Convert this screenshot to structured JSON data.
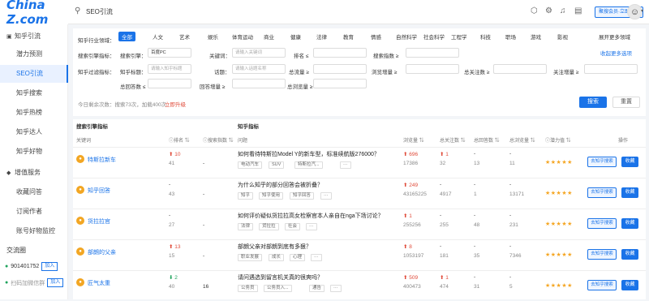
{
  "logo": "China Z.com",
  "topbar": {
    "title": "SEO引流",
    "buy": "聚搜会员·立即升级"
  },
  "sidebar": {
    "section1": "知乎引流",
    "items": [
      "潜力预测",
      "SEO引流",
      "知乎搜索",
      "知乎热榜",
      "知乎达人",
      "知乎好物"
    ],
    "section2": "增值服务",
    "items2": [
      "收藏问答",
      "订阅作者",
      "账号好物监控"
    ],
    "contact_title": "交流圈",
    "contacts": [
      {
        "id": "901401752",
        "add": "加入"
      },
      {
        "id": "扫码加微信群",
        "add": "加入"
      }
    ]
  },
  "filter": {
    "industry_label": "知乎行业领域：",
    "categories": [
      "全部",
      "人文",
      "艺术",
      "娱乐",
      "体育运动",
      "商业",
      "健康",
      "法律",
      "教育",
      "情感",
      "自然科学",
      "社会科学",
      "工程学",
      "科技",
      "职场",
      "游戏",
      "影视"
    ],
    "expand": "展开更多领域",
    "collapse": "收起更多选项",
    "search_filter": "搜索引擎指标：",
    "engine_label": "搜索引擎：",
    "engine_value": "百度PC",
    "keyword_label": "关键词：",
    "keyword_placeholder": "请输入关键词",
    "rank_label": "排名 ≤",
    "search_vol_label": "搜索指数 ≥",
    "zhihu_filter": "知乎过滤指标：",
    "zhihu_title_label": "知乎标题：",
    "zhihu_title_placeholder": "请输入知乎标题",
    "topic_label": "话题：",
    "topic_placeholder": "请输入话题名称",
    "total_flow_label": "总流量 ≥",
    "view_inc_label": "浏览增量 ≥",
    "total_follow_label": "总关注数 ≥",
    "follow_inc_label": "关注增量 ≥",
    "total_answer_label": "总回答数 ≤",
    "answer_inc_label": "回答增量 ≥",
    "total_view_label": "总浏览量 ≥",
    "quota": "今日剩余次数：搜索73次，加载400次",
    "upgrade": "立即升级",
    "search_btn": "搜索",
    "reset_btn": "重置"
  },
  "table": {
    "group1": "搜索引擎指标",
    "group2": "知乎指标",
    "cols": [
      "关键词",
      "ⓘ排名 ⇅",
      "ⓘ搜索指数 ⇅",
      "问题",
      "浏览量 ⇅",
      "总关注数 ⇅",
      "总回答数 ⇅",
      "总浏览量 ⇅",
      "ⓘ潜力值 ⇅",
      "操作"
    ],
    "go_btn": "去知乎搜索",
    "fav_btn": "收藏",
    "rows": [
      {
        "kw": "特斯拉新车",
        "rank": "10",
        "rank_dir": "up",
        "rank_sub": "41",
        "index": "-",
        "q": "如何看待特斯拉Model Y的新车型，标准续航版276000？",
        "tags": [
          "电动汽车",
          "SUV",
          "特斯拉汽..."
        ],
        "view": "696",
        "view_dir": "up",
        "view_sub": "17386",
        "follow": "1",
        "follow_dir": "up",
        "follow_sub": "32",
        "answer": "-",
        "answer_sub": "13",
        "total": "-",
        "total_sub": "11",
        "stars": "★★★★★"
      },
      {
        "kw": "知乎回答",
        "rank": "-",
        "rank_dir": "",
        "rank_sub": "43",
        "index": "-",
        "q": "为什么知乎的部分回答会被折叠？",
        "tags": [
          "知乎",
          "知乎使用",
          "知乎回答"
        ],
        "view": "249",
        "view_dir": "up",
        "view_sub": "43165225",
        "follow": "-",
        "follow_dir": "",
        "follow_sub": "4917",
        "answer": "-",
        "answer_sub": "1",
        "total": "-",
        "total_sub": "13171",
        "stars": "★★★★★"
      },
      {
        "kw": "货拉拉官",
        "rank": "-",
        "rank_dir": "",
        "rank_sub": "27",
        "index": "-",
        "q": "如何评价疑似货拉拉高女检察官本人亲自在nga下场讨论？",
        "tags": [
          "法律",
          "货拉拉",
          "社会"
        ],
        "view": "1",
        "view_dir": "up",
        "view_sub": "255256",
        "follow": "-",
        "follow_dir": "",
        "follow_sub": "255",
        "answer": "-",
        "answer_sub": "48",
        "total": "-",
        "total_sub": "231",
        "stars": "★★★★★"
      },
      {
        "kw": "部朗的父亲",
        "rank": "13",
        "rank_dir": "up",
        "rank_sub": "15",
        "index": "-",
        "q": "部朗父亲对部朗到底有多狠？",
        "tags": [
          "职业发展",
          "成长",
          "心理"
        ],
        "view": "8",
        "view_dir": "up",
        "view_sub": "1053197",
        "follow": "-",
        "follow_dir": "",
        "follow_sub": "181",
        "answer": "-",
        "answer_sub": "35",
        "total": "-",
        "total_sub": "7346",
        "stars": "★★★★★"
      },
      {
        "kw": "匠气太重",
        "rank": "2",
        "rank_dir": "down",
        "rank_sub": "40",
        "index": "16",
        "q": "请问遇选到留言机关真的很爽吗？",
        "tags": [
          "公务员",
          "公务员入...",
          "通告"
        ],
        "view": "509",
        "view_dir": "up",
        "view_sub": "400473",
        "follow": "1",
        "follow_dir": "up",
        "follow_sub": "474",
        "answer": "-",
        "answer_sub": "31",
        "total": "-",
        "total_sub": "5",
        "stars": "★★★★★"
      }
    ]
  }
}
